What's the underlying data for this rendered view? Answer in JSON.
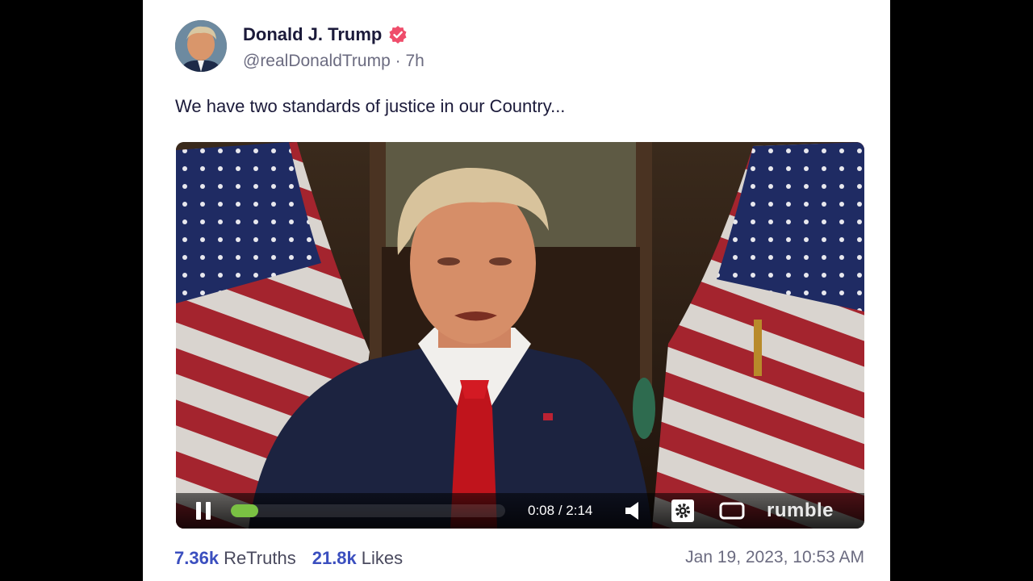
{
  "post": {
    "author_name": "Donald J. Trump",
    "handle": "@realDonaldTrump",
    "separator": " · ",
    "age": "7h",
    "text": "We have two standards of justice in our Country...",
    "verified_icon": "verified-badge-icon"
  },
  "video": {
    "current_time": "0:08",
    "time_separator": " / ",
    "duration": "2:14",
    "progress_fraction": 0.06,
    "brand": "rumble",
    "controls": {
      "play_state": "playing",
      "icons": [
        "pause-icon",
        "volume-icon",
        "settings-gear-icon",
        "fullscreen-icon"
      ]
    }
  },
  "stats": {
    "retruths_count": "7.36k",
    "retruths_label": "ReTruths",
    "likes_count": "21.8k",
    "likes_label": "Likes",
    "timestamp": "Jan 19, 2023, 10:53 AM"
  },
  "colors": {
    "accent": "#3b4fbf",
    "verified": "#ef4d6b",
    "progress": "#7ac143"
  }
}
